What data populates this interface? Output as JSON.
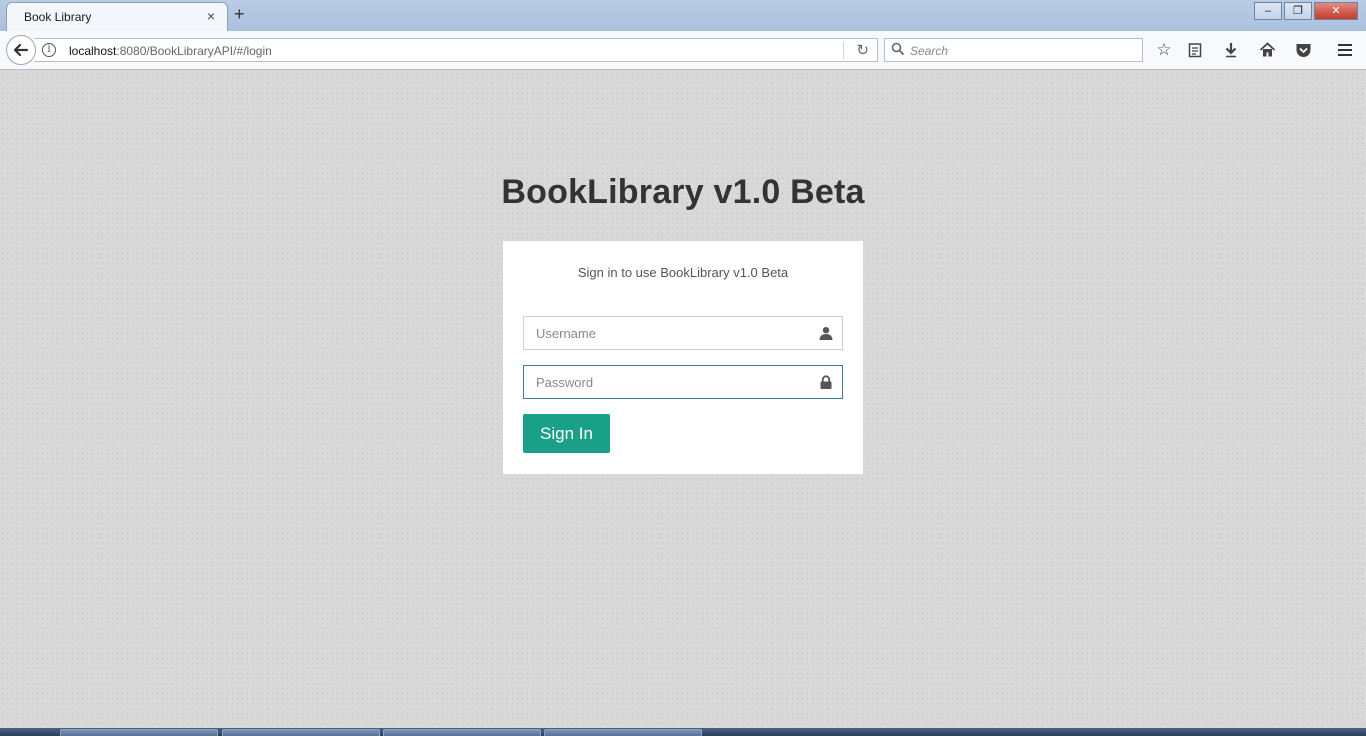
{
  "browser": {
    "tab_title": "Book Library",
    "tab_close": "×",
    "new_tab": "+",
    "url_host": "localhost",
    "url_rest": ":8080/BookLibraryAPI/#/login",
    "search_placeholder": "Search",
    "window_buttons": [
      "–",
      "❐",
      "✕"
    ]
  },
  "page": {
    "app_title": "BookLibrary v1.0 Beta",
    "card_subtitle": "Sign in to use BookLibrary v1.0 Beta",
    "username_placeholder": "Username",
    "password_placeholder": "Password",
    "signin_label": "Sign In"
  },
  "colors": {
    "accent": "#1aa086",
    "focus_border": "#3c7a9e",
    "title_text": "#333333"
  },
  "icons": {
    "username": "user-icon",
    "password": "lock-icon"
  }
}
